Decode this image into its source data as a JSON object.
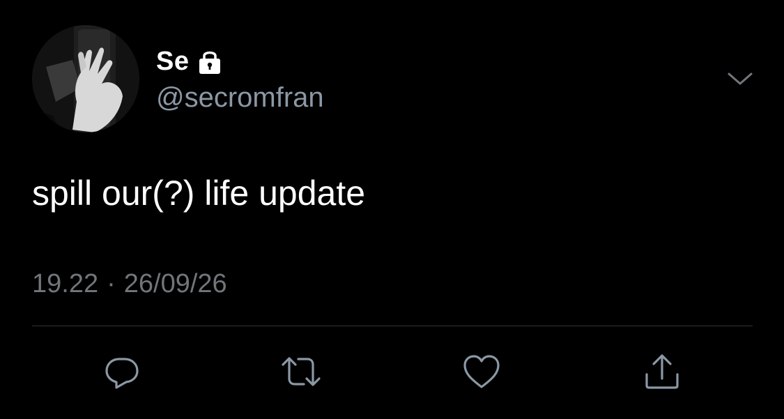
{
  "author": {
    "display_name": "Se",
    "handle": "@secromfran",
    "protected_icon": "lock-icon",
    "avatar": "avatar-photo"
  },
  "tweet": {
    "text": "spill our(?) life update",
    "time": "19.22",
    "separator": "·",
    "date": "26/09/26"
  },
  "menu": {
    "icon": "chevron-down-icon"
  },
  "actions": [
    {
      "name": "reply",
      "icon": "reply-icon"
    },
    {
      "name": "retweet",
      "icon": "retweet-icon"
    },
    {
      "name": "like",
      "icon": "heart-icon"
    },
    {
      "name": "share",
      "icon": "share-icon"
    }
  ],
  "colors": {
    "background": "#000000",
    "primary_text": "#ffffff",
    "secondary_text": "#71767b",
    "handle_text": "#8b98a5",
    "divider": "#2f3336",
    "icon": "#8b98a5"
  }
}
